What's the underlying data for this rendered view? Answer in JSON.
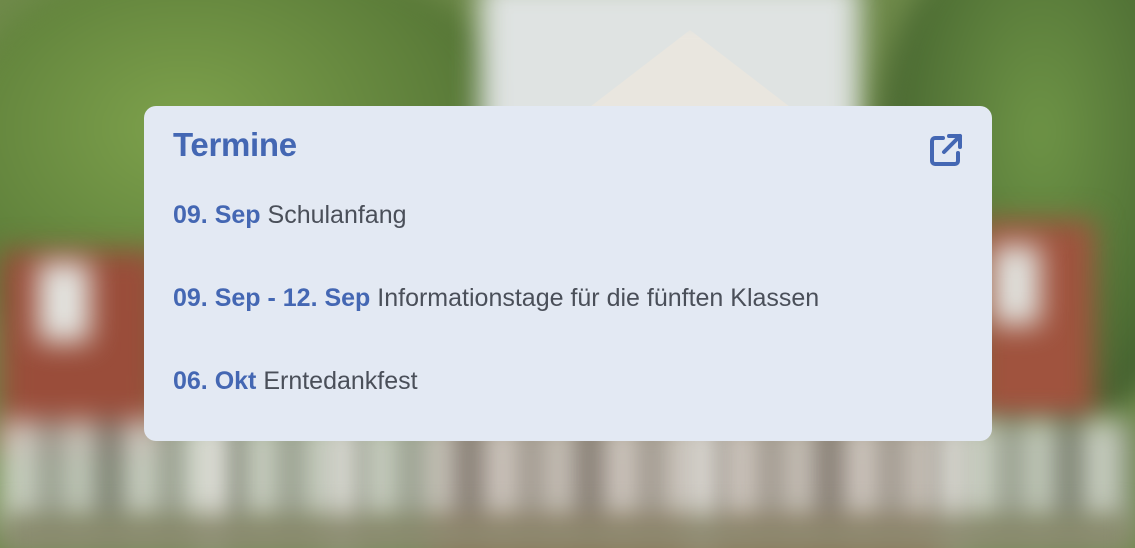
{
  "widget": {
    "title": "Termine",
    "open_icon": "external-link-icon",
    "accent_color": "#4467b3",
    "card_background": "#e3e9f3"
  },
  "events": [
    {
      "date": "09. Sep",
      "name": "Schulanfang"
    },
    {
      "date": "09. Sep - 12. Sep",
      "name": "Informationstage für die fünften Klassen"
    },
    {
      "date": "06. Okt",
      "name": "Erntedankfest"
    }
  ]
}
